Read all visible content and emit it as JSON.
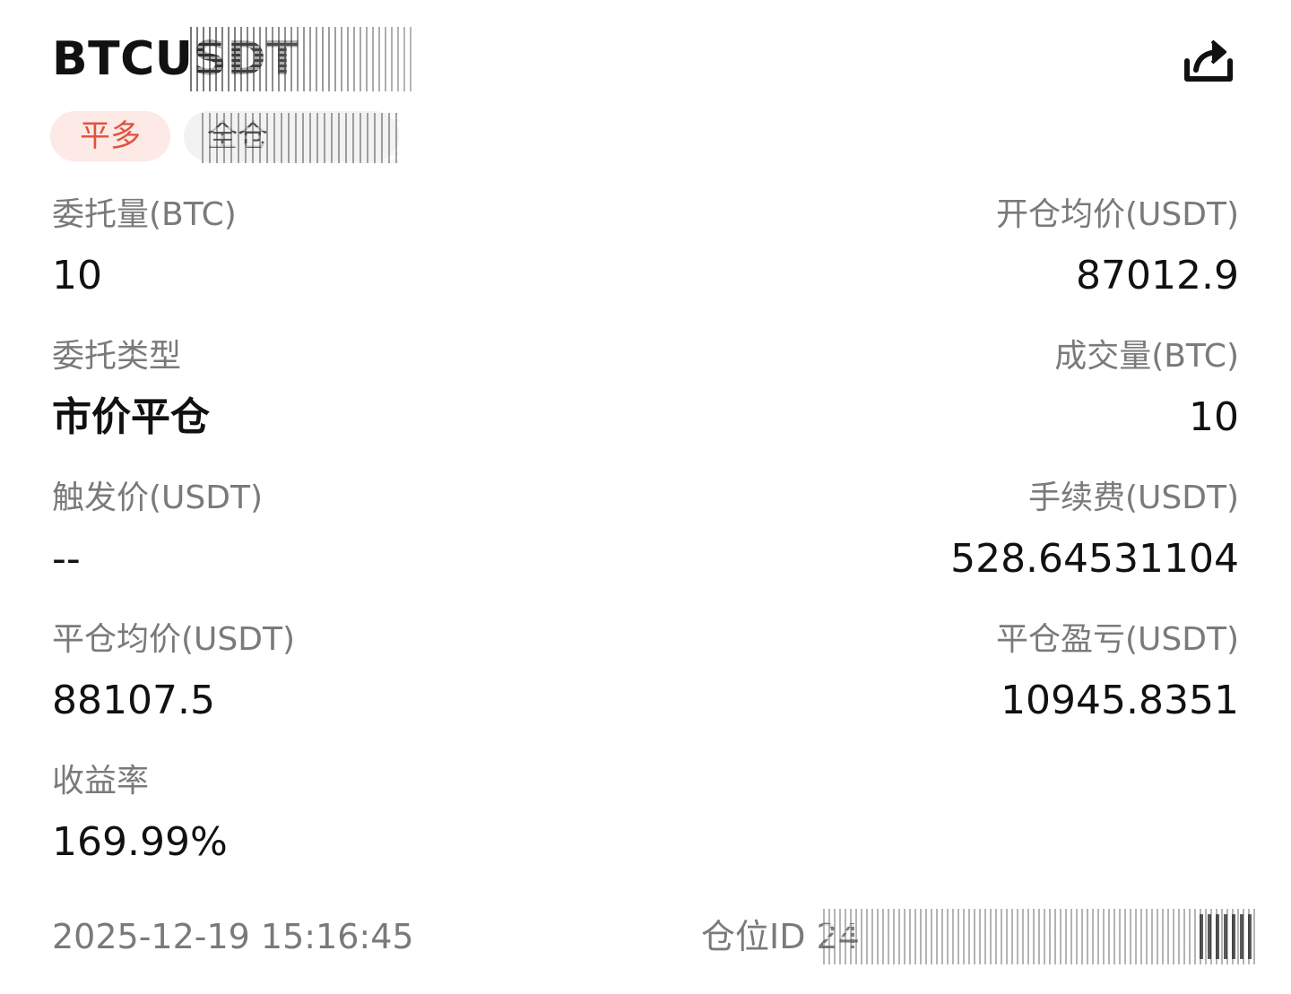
{
  "header": {
    "symbol": "BTCUSDT",
    "share_icon": "share-icon",
    "direction_tag": "平多",
    "mode_tag": "全仓"
  },
  "fields": {
    "order_qty": {
      "label": "委托量(BTC)",
      "value": "10"
    },
    "avg_open_price": {
      "label": "开仓均价(USDT)",
      "value": "87012.9"
    },
    "order_type": {
      "label": "委托类型",
      "value": "市价平仓"
    },
    "filled_qty": {
      "label": "成交量(BTC)",
      "value": "10"
    },
    "trigger_price": {
      "label": "触发价(USDT)",
      "value": "--"
    },
    "fee": {
      "label": "手续费(USDT)",
      "value": "528.64531104"
    },
    "avg_close_price": {
      "label": "平仓均价(USDT)",
      "value": "88107.5"
    },
    "close_pnl": {
      "label": "平仓盈亏(USDT)",
      "value": "10945.8351"
    },
    "roi": {
      "label": "收益率",
      "value": "169.99%"
    }
  },
  "footer": {
    "datetime": "2025-12-19 15:16:45",
    "position_id": "仓位ID 24"
  },
  "colors": {
    "direction_tag_bg": "#fde9e6",
    "direction_tag_text": "#e0533e",
    "label_text": "#7a7a7a",
    "value_text": "#111111"
  }
}
